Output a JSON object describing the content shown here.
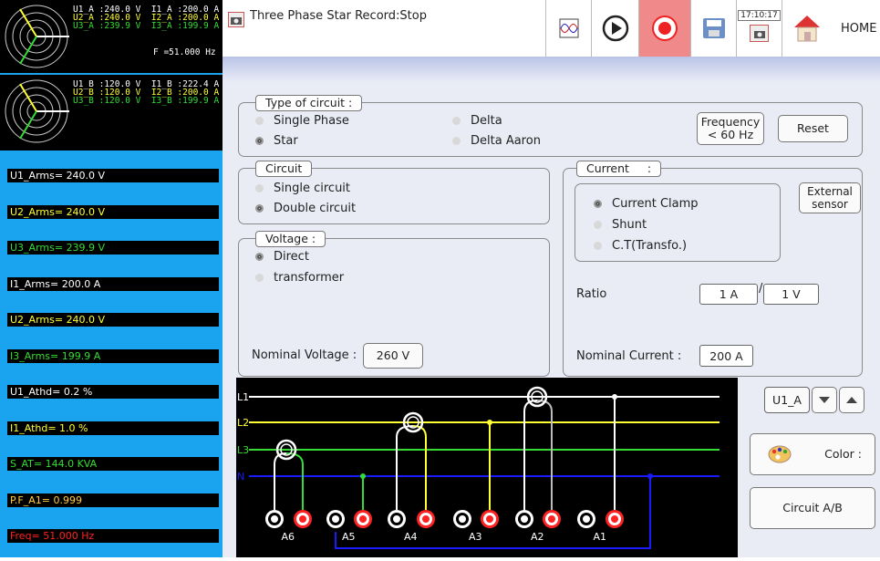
{
  "phasor_a": {
    "rows": [
      {
        "u": "U1_A :240.0 V",
        "i": "I1_A :200.0 A",
        "color": "#ffffff"
      },
      {
        "u": "U2_A :240.0 V",
        "i": "I2_A :200.0 A",
        "color": "#ffff33"
      },
      {
        "u": "U3_A :239.9 V",
        "i": "I3_A :199.9 A",
        "color": "#33dd33"
      }
    ],
    "freq": "F =51.000 Hz"
  },
  "phasor_b": {
    "rows": [
      {
        "u": "U1_B :120.0 V",
        "i": "I1_B :222.4 A",
        "color": "#ffffff"
      },
      {
        "u": "U2_B :120.0 V",
        "i": "I2_B :200.0 A",
        "color": "#ffff33"
      },
      {
        "u": "U3_B :120.0 V",
        "i": "I3_B :199.9 A",
        "color": "#33dd33"
      }
    ]
  },
  "measurements": [
    {
      "text": "U1_Arms= 240.0 V",
      "color": "#ffffff"
    },
    {
      "text": "U2_Arms= 240.0 V",
      "color": "#ffff33"
    },
    {
      "text": "U3_Arms= 239.9 V",
      "color": "#33dd33"
    },
    {
      "text": "I1_Arms= 200.0 A",
      "color": "#ffffff"
    },
    {
      "text": "U2_Arms= 240.0 V",
      "color": "#ffff33"
    },
    {
      "text": "I3_Arms= 199.9 A",
      "color": "#33dd33"
    },
    {
      "text": "U1_Athd= 0.2 %",
      "color": "#ffffff"
    },
    {
      "text": "I1_Athd= 1.0 %",
      "color": "#ffff33"
    },
    {
      "text": "S_AT= 144.0 KVA",
      "color": "#33dd33"
    },
    {
      "text": "P.F_A1= 0.999",
      "color": "#ffcc44"
    },
    {
      "text": "Freq= 51.000 Hz",
      "color": "#ff2222"
    }
  ],
  "header": {
    "title": "Three Phase Star Record:Stop",
    "time": "17:10:17",
    "home_label": "HOME"
  },
  "type_of_circuit": {
    "legend": "Type of circuit :",
    "options": [
      "Single Phase",
      "Star",
      "Delta",
      "Delta Aaron"
    ],
    "selected": "Star",
    "frequency_btn": "Frequency\n< 60 Hz",
    "reset_btn": "Reset"
  },
  "circuit": {
    "legend": "Circuit",
    "options": [
      "Single circuit",
      "Double circuit"
    ],
    "selected": "Double circuit"
  },
  "voltage": {
    "legend": "Voltage :",
    "options": [
      "Direct",
      "transformer"
    ],
    "selected": "Direct",
    "nominal_label": "Nominal Voltage :",
    "nominal_value": "260 V"
  },
  "current": {
    "legend": "Current     :",
    "external_btn": "External\nsensor",
    "options": [
      "Current Clamp",
      "Shunt",
      "C.T(Transfo.)"
    ],
    "selected": "Current Clamp",
    "ratio_label": "Ratio",
    "ratio_primary": "1 A",
    "ratio_sep": "/",
    "ratio_secondary": "1 V",
    "nominal_label": "Nominal Current :",
    "nominal_value": "200 A"
  },
  "wiring": {
    "lines": [
      "L1",
      "L2",
      "L3",
      "N"
    ],
    "terminals": [
      "A6",
      "A5",
      "A4",
      "A3",
      "A2",
      "A1"
    ],
    "colors": {
      "L1": "#ffffff",
      "L2": "#ffff33",
      "L3": "#33dd33",
      "N": "#1a1aff",
      "red": "#ff2222"
    }
  },
  "right_controls": {
    "channel": "U1_A",
    "color_btn": "Color :",
    "circuit_ab_btn": "Circuit A/B"
  }
}
